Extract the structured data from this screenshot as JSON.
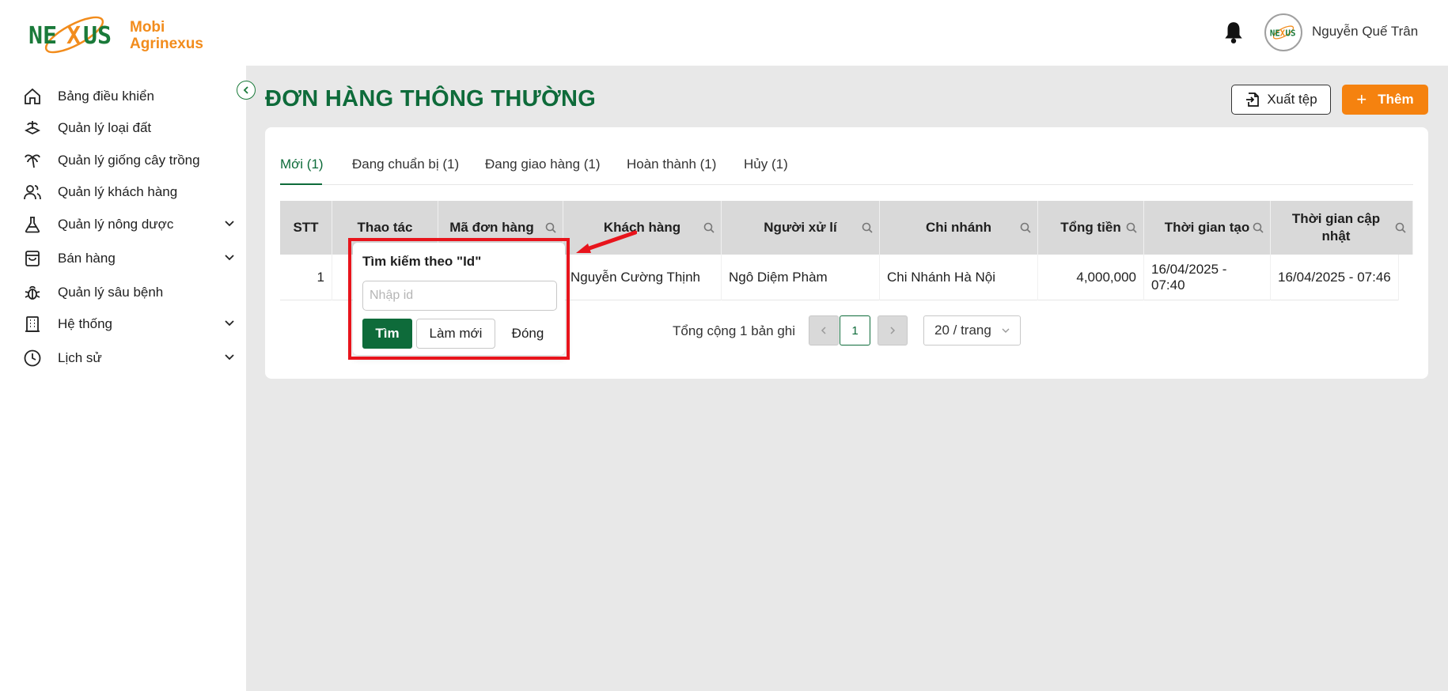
{
  "brand": {
    "line1": "Mobi",
    "line2": "Agrinexus",
    "mark": "NEXUS"
  },
  "header": {
    "username": "Nguyễn Quế Trân"
  },
  "sidebar": {
    "items": [
      {
        "label": "Bảng điều khiển",
        "icon": "home-icon",
        "expandable": false
      },
      {
        "label": "Quản lý loại đất",
        "icon": "soil-icon",
        "expandable": false
      },
      {
        "label": "Quản lý giống cây trồng",
        "icon": "palm-tree-icon",
        "expandable": false
      },
      {
        "label": "Quản lý khách hàng",
        "icon": "users-icon",
        "expandable": false
      },
      {
        "label": "Quản lý nông dược",
        "icon": "flask-icon",
        "expandable": true
      },
      {
        "label": "Bán hàng",
        "icon": "shopping-bag-icon",
        "expandable": true
      },
      {
        "label": "Quản lý sâu bệnh",
        "icon": "bug-icon",
        "expandable": false
      },
      {
        "label": "Hệ thống",
        "icon": "building-icon",
        "expandable": true
      },
      {
        "label": "Lịch sử",
        "icon": "clock-icon",
        "expandable": true
      }
    ]
  },
  "page": {
    "title": "ĐƠN HÀNG THÔNG THƯỜNG",
    "export_label": "Xuất tệp",
    "add_label": "Thêm"
  },
  "tabs": [
    {
      "label": "Mới (1)",
      "active": true
    },
    {
      "label": "Đang chuẩn bị (1)",
      "active": false
    },
    {
      "label": "Đang giao hàng (1)",
      "active": false
    },
    {
      "label": "Hoàn thành (1)",
      "active": false
    },
    {
      "label": "Hủy (1)",
      "active": false
    }
  ],
  "table": {
    "columns": [
      "STT",
      "Thao tác",
      "Mã đơn hàng",
      "Khách hàng",
      "Người xử lí",
      "Chi nhánh",
      "Tổng tiền",
      "Thời gian tạo",
      "Thời gian cập nhật"
    ],
    "rows": [
      {
        "stt": "1",
        "customer": "Nguyễn Cường Thịnh",
        "handler": "Ngô Diệm Phàm",
        "branch": "Chi Nhánh Hà Nội",
        "total": "4,000,000",
        "created": "16/04/2025 - 07:40",
        "updated": "16/04/2025 - 07:46"
      }
    ]
  },
  "pagination": {
    "total_text": "Tổng cộng 1 bản ghi",
    "current_page": "1",
    "page_size": "20 / trang"
  },
  "filter_popup": {
    "title": "Tìm kiếm theo \"Id\"",
    "placeholder": "Nhập id",
    "search_label": "Tìm",
    "reset_label": "Làm mới",
    "close_label": "Đóng"
  },
  "colors": {
    "primary": "#0e6b3a",
    "accent": "#f5820f",
    "highlight": "#e8141c",
    "background": "#e8e8e8"
  }
}
